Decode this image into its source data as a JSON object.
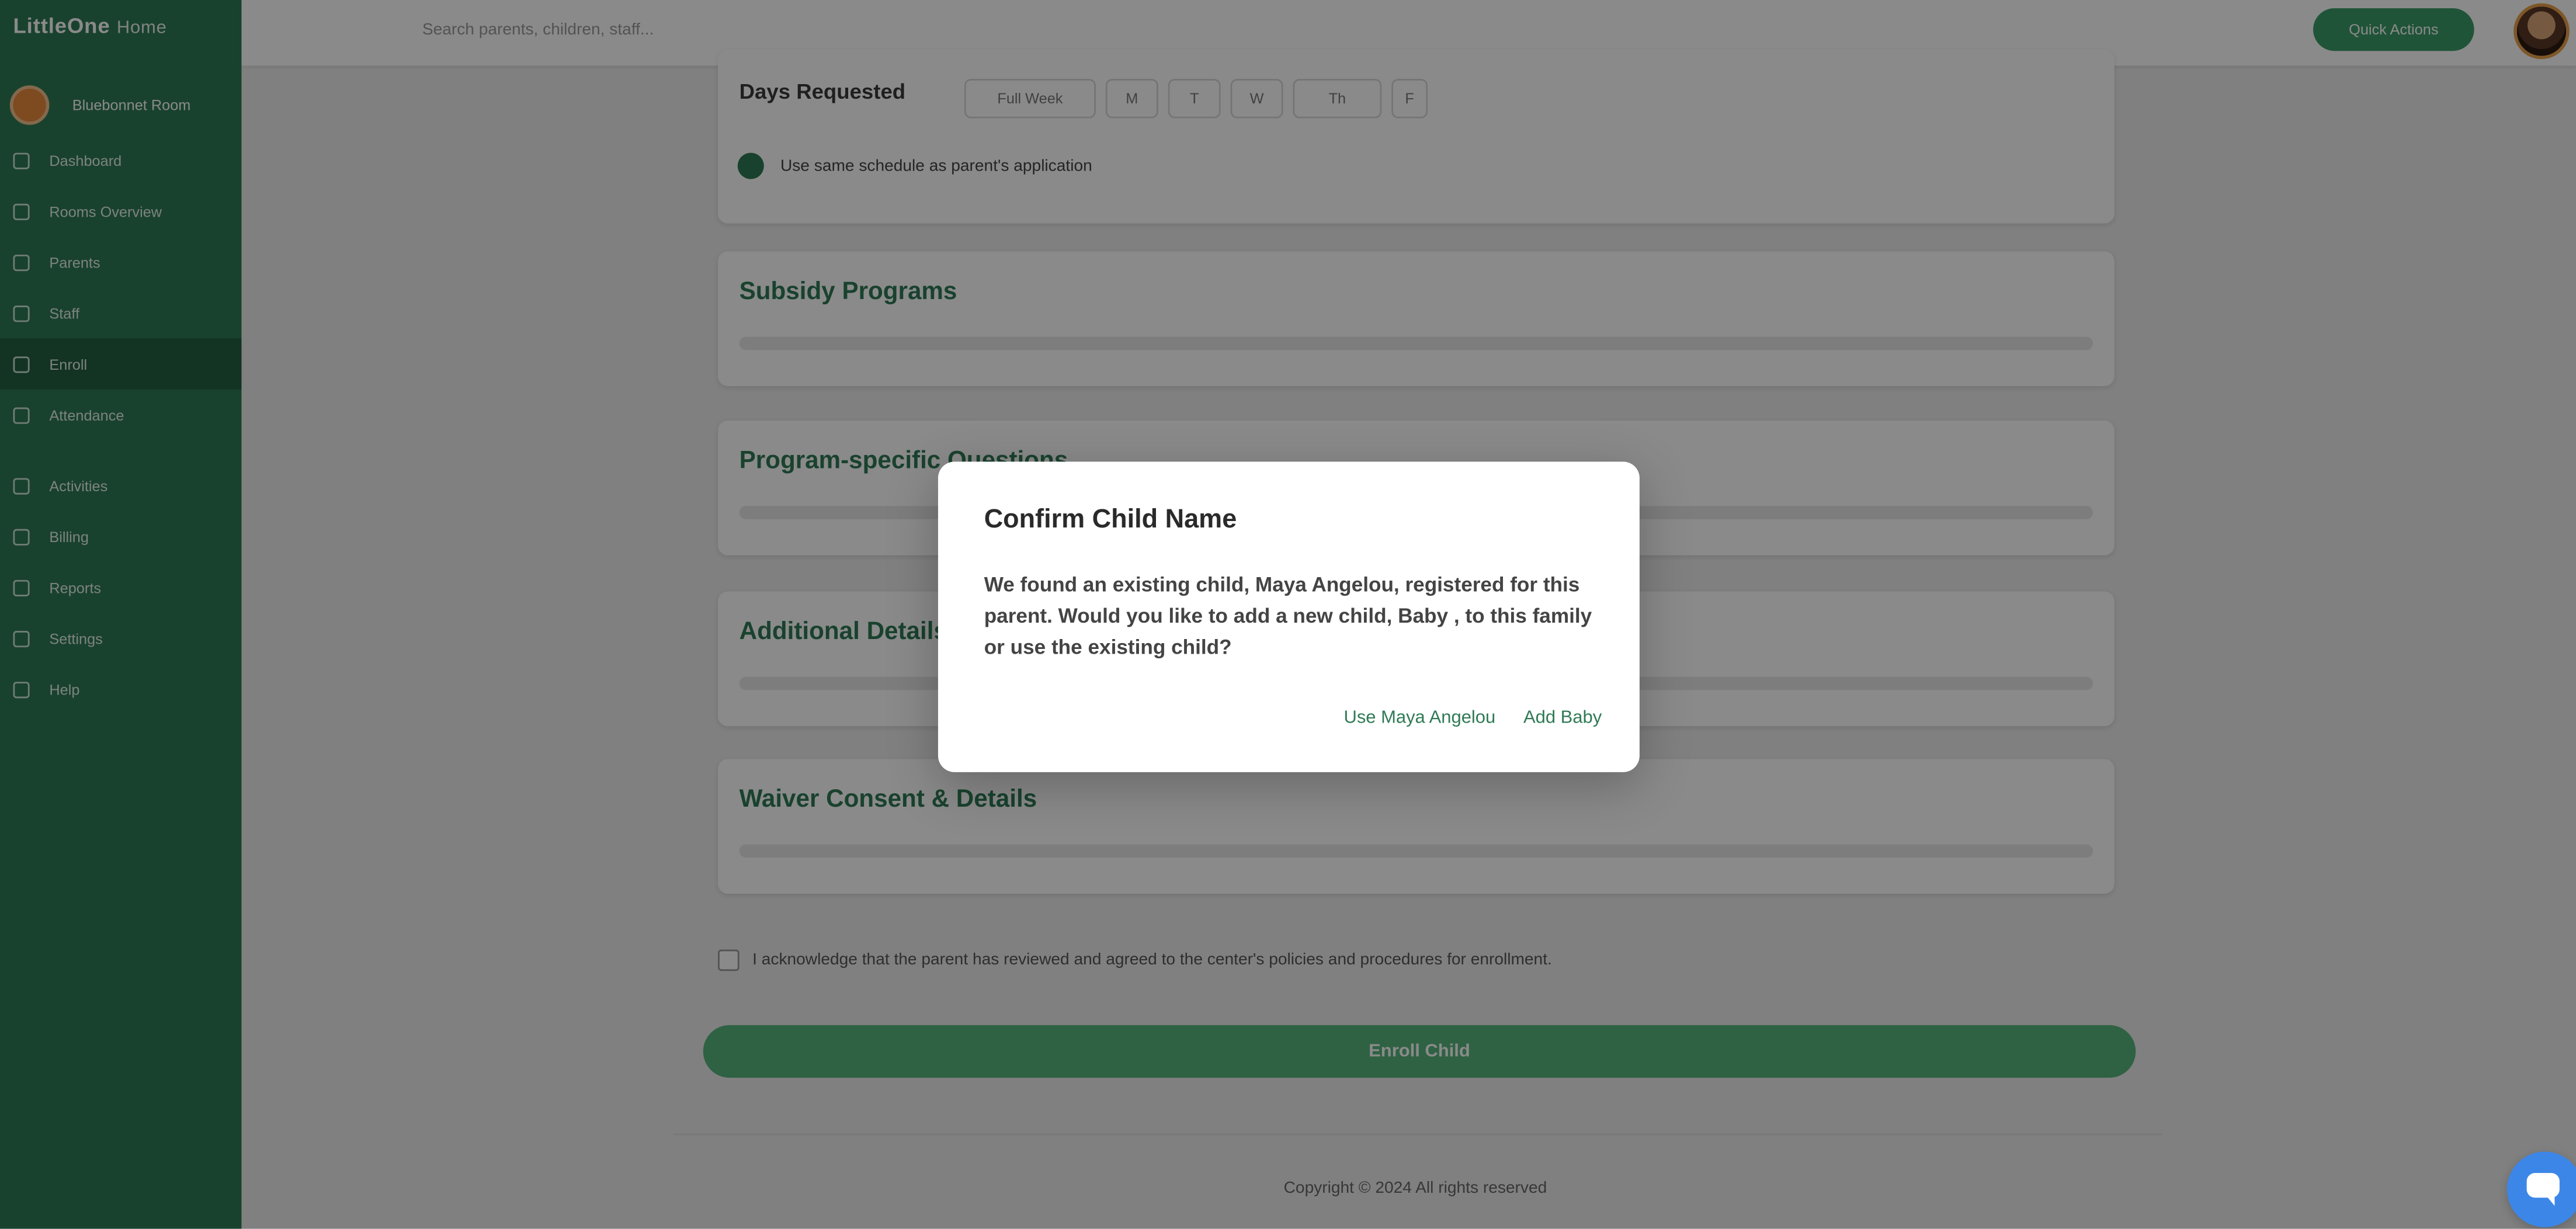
{
  "app": {
    "logo_text": "LittleOne",
    "logo_sub": "Home"
  },
  "sidebar": {
    "school_name": "Bluebonnet Room",
    "items": [
      {
        "label": "Dashboard",
        "icon": "dashboard-icon"
      },
      {
        "label": "Rooms Overview",
        "icon": "rooms-icon"
      },
      {
        "label": "Parents",
        "icon": "parents-icon"
      },
      {
        "label": "Staff",
        "icon": "staff-icon"
      },
      {
        "label": "Enroll",
        "icon": "enroll-icon",
        "active": true
      },
      {
        "label": "Attendance",
        "icon": "attendance-icon"
      },
      {
        "label": "Activities",
        "icon": "activities-icon"
      },
      {
        "label": "Billing",
        "icon": "billing-icon"
      },
      {
        "label": "Reports",
        "icon": "reports-icon"
      },
      {
        "label": "Settings",
        "icon": "settings-icon"
      },
      {
        "label": "Help",
        "icon": "help-icon"
      }
    ]
  },
  "topbar": {
    "search_hint": "Search parents, children, staff...",
    "cta_label": "Quick Actions"
  },
  "form": {
    "days_title": "Days Requested",
    "day_options": [
      "Full Week",
      "M",
      "T",
      "W",
      "Th",
      "F"
    ],
    "check_label": "Use same schedule as parent's application",
    "sections": [
      {
        "title": "Subsidy Programs"
      },
      {
        "title": "Program-specific Questions"
      },
      {
        "title": "Additional Details"
      },
      {
        "title": "Waiver Consent & Details"
      }
    ],
    "ack_text": "I acknowledge that the parent has reviewed and agreed to the center's policies and procedures for enrollment.",
    "submit_label": "Enroll Child"
  },
  "footer": {
    "text": "Copyright © 2024 All rights reserved"
  },
  "modal": {
    "title": "Confirm Child Name",
    "body": "We found an existing child, Maya Angelou, registered for this parent. Would you like to add a new child, Baby , to this family or use the existing child?",
    "use_existing_label": "Use Maya Angelou",
    "add_new_label": "Add Baby"
  },
  "colors": {
    "brand": "#2f7a55",
    "accent_link": "#2f7a55",
    "chat": "#3c86e8"
  }
}
